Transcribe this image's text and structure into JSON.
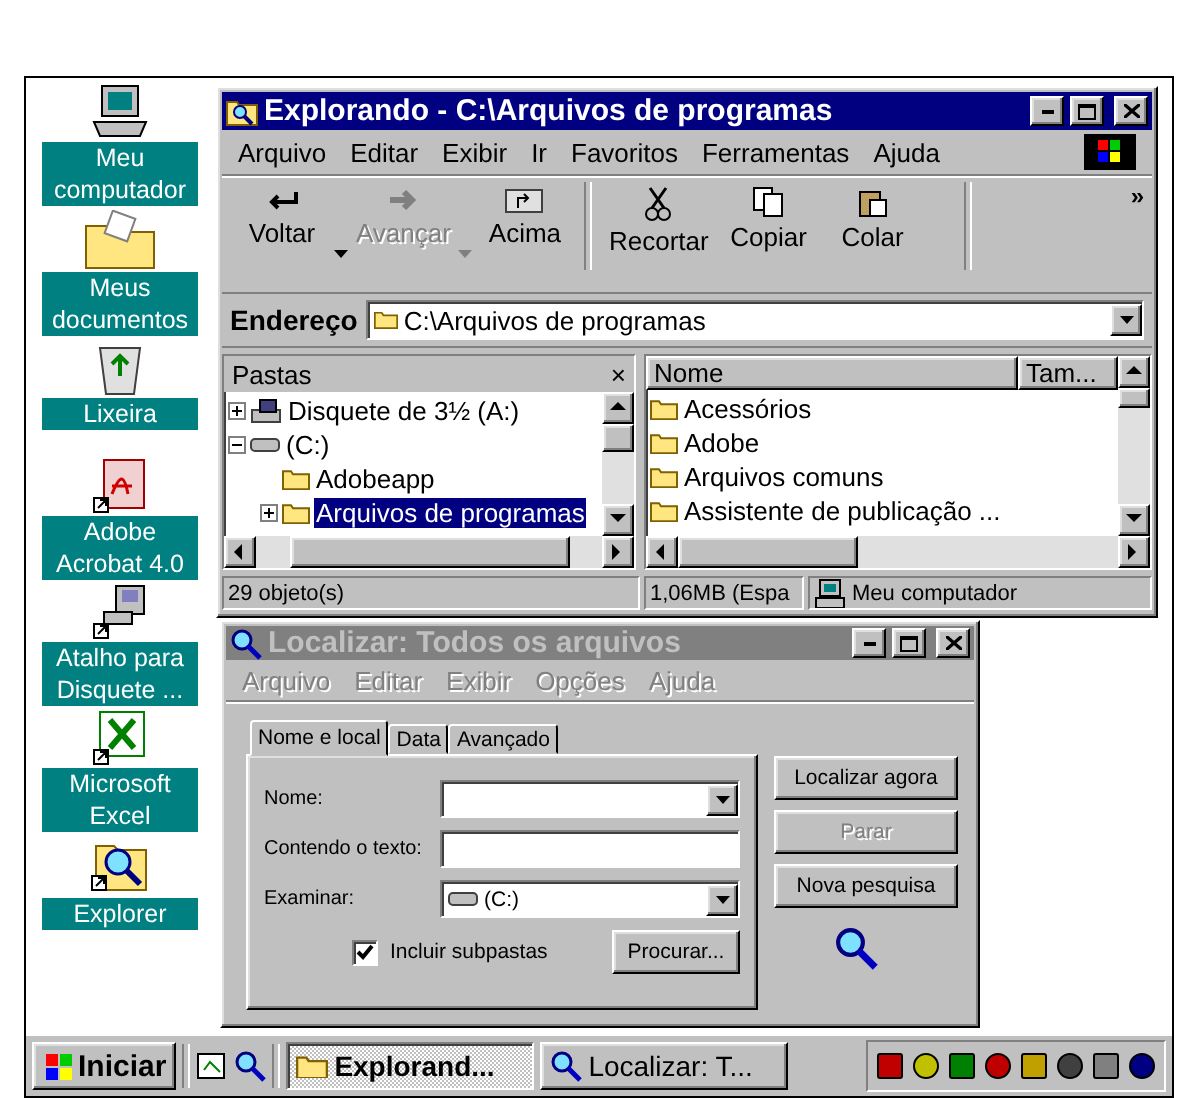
{
  "desktop_icons": [
    {
      "label": "Meu computador",
      "kind": "computer"
    },
    {
      "label": "Meus documentos",
      "kind": "folder"
    },
    {
      "label": "Lixeira",
      "kind": "recycle"
    },
    {
      "label": "Adobe Acrobat 4.0",
      "kind": "acrobat"
    },
    {
      "label": "Atalho para Disquete ...",
      "kind": "floppy"
    },
    {
      "label": "Microsoft Excel",
      "kind": "excel"
    },
    {
      "label": "Explorer",
      "kind": "explorer"
    }
  ],
  "explorer": {
    "title": "Explorando - C:\\Arquivos de programas",
    "active": true,
    "menu": [
      "Arquivo",
      "Editar",
      "Exibir",
      "Ir",
      "Favoritos",
      "Ferramentas",
      "Ajuda"
    ],
    "toolbar": [
      {
        "label": "Voltar",
        "kind": "back",
        "disabled": false,
        "dropdown": true
      },
      {
        "label": "Avançar",
        "kind": "forward",
        "disabled": true,
        "dropdown": true
      },
      {
        "label": "Acima",
        "kind": "up",
        "disabled": false,
        "dropdown": false
      },
      {
        "label": "Recortar",
        "kind": "cut",
        "disabled": false,
        "dropdown": false
      },
      {
        "label": "Copiar",
        "kind": "copy",
        "disabled": false,
        "dropdown": false
      },
      {
        "label": "Colar",
        "kind": "paste",
        "disabled": false,
        "dropdown": false
      }
    ],
    "toolbar_more": "»",
    "address": {
      "label": "Endereço",
      "value": "C:\\Arquivos de programas"
    },
    "folders_pane": {
      "title": "Pastas",
      "close": "×",
      "tree": [
        {
          "label": "Disquete de 3½ (A:)",
          "kind": "floppy",
          "expanded": false,
          "selected": false
        },
        {
          "label": "(C:)",
          "kind": "drive",
          "expanded": true,
          "selected": false,
          "children": [
            {
              "label": "Adobeapp",
              "kind": "folder",
              "selected": false
            },
            {
              "label": "Arquivos de programas",
              "kind": "folder",
              "expanded": false,
              "selected": true
            }
          ]
        }
      ]
    },
    "file_list": {
      "columns": [
        "Nome",
        "Tam..."
      ],
      "rows": [
        {
          "name": "Acessórios",
          "selected": false
        },
        {
          "name": "Adobe",
          "selected": false
        },
        {
          "name": "Arquivos comuns",
          "selected": false
        },
        {
          "name": "Assistente de publicação ...",
          "selected": false
        }
      ]
    },
    "status_bar": [
      "29 objeto(s)",
      "1,06MB (Espa",
      "Meu computador"
    ]
  },
  "find": {
    "title": "Localizar: Todos os arquivos",
    "active": false,
    "menu": [
      {
        "label": "Arquivo",
        "disabled": true
      },
      {
        "label": "Editar",
        "disabled": true
      },
      {
        "label": "Exibir",
        "disabled": true
      },
      {
        "label": "Opções",
        "disabled": true
      },
      {
        "label": "Ajuda",
        "disabled": true
      }
    ],
    "tabs": [
      {
        "label": "Nome e local",
        "selected": true
      },
      {
        "label": "Data",
        "selected": false
      },
      {
        "label": "Avançado",
        "selected": false
      }
    ],
    "fields": [
      {
        "label": "Nome:",
        "kind": "combo"
      },
      {
        "label": "Contendo o texto:",
        "kind": "text"
      },
      {
        "label": "Examinar:",
        "kind": "drive-combo",
        "value": "(C:)"
      }
    ],
    "include_subfolders": {
      "label": "Incluir subpastas",
      "checked": true
    },
    "browse_button": "Procurar...",
    "buttons": [
      {
        "label": "Localizar agora",
        "disabled": false
      },
      {
        "label": "Parar",
        "disabled": true
      },
      {
        "label": "Nova pesquisa",
        "disabled": false
      }
    ]
  },
  "taskbar": {
    "start": "Iniciar",
    "tasks": [
      {
        "label": "Explorand...",
        "kind": "explorer",
        "selected": true
      },
      {
        "label": "Localizar: T...",
        "kind": "find",
        "selected": false
      }
    ]
  }
}
